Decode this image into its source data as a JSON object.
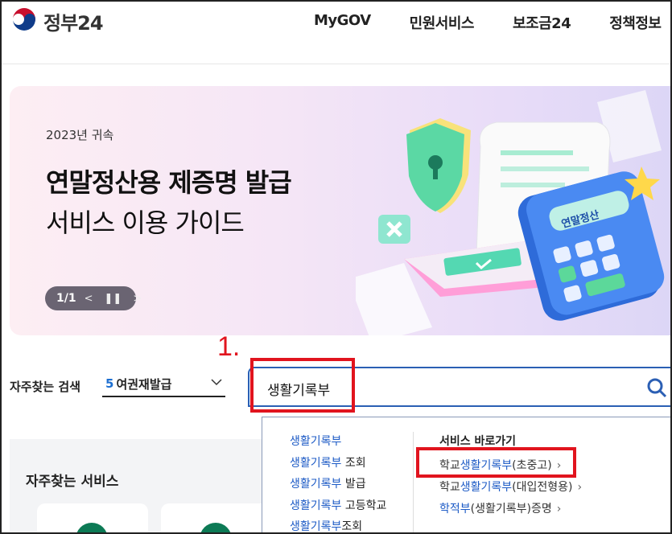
{
  "header": {
    "logo_text": "정부24",
    "nav": [
      "MyGOV",
      "민원서비스",
      "보조금24",
      "정책정보"
    ]
  },
  "banner": {
    "year_label": "2023년 귀속",
    "title": "연말정산용 제증명 발급",
    "subtitle": "서비스 이용 가이드",
    "counter": "1/1",
    "prev_icon": "chevron-left-icon",
    "pause_icon": "pause-icon",
    "next_icon": "chevron-right-icon",
    "calculator_label": "연말정산"
  },
  "annotation": {
    "step": "1."
  },
  "frequent_search": {
    "label": "자주찾는 검색",
    "rank": "5",
    "term": "여권재발급"
  },
  "search": {
    "value": "생활기록부"
  },
  "autocomplete": {
    "keyword": "생활기록부",
    "suggestions": [
      {
        "hl": "생활기록부",
        "rest": ""
      },
      {
        "hl": "생활기록부",
        "rest": " 조회"
      },
      {
        "hl": "생활기록부",
        "rest": " 발급"
      },
      {
        "hl": "생활기록부",
        "rest": " 고등학교"
      },
      {
        "hl": "생활기록부",
        "rest": "조회"
      }
    ],
    "shortcut_title": "서비스 바로가기",
    "shortcuts": [
      {
        "pre": "학교",
        "hl": "생활기록부",
        "post": "(초중고)"
      },
      {
        "pre": "학교",
        "hl": "생활기록부",
        "post": "(대입전형용)"
      },
      {
        "pre": "",
        "hl": "학적부",
        "post": "(생활기록부)증명"
      }
    ]
  },
  "frequent_services": {
    "heading": "자주찾는 서비스"
  },
  "colors": {
    "accent_blue": "#1d5bc6",
    "annotation_red": "#e1141e",
    "brand_green": "#0c7a55"
  }
}
